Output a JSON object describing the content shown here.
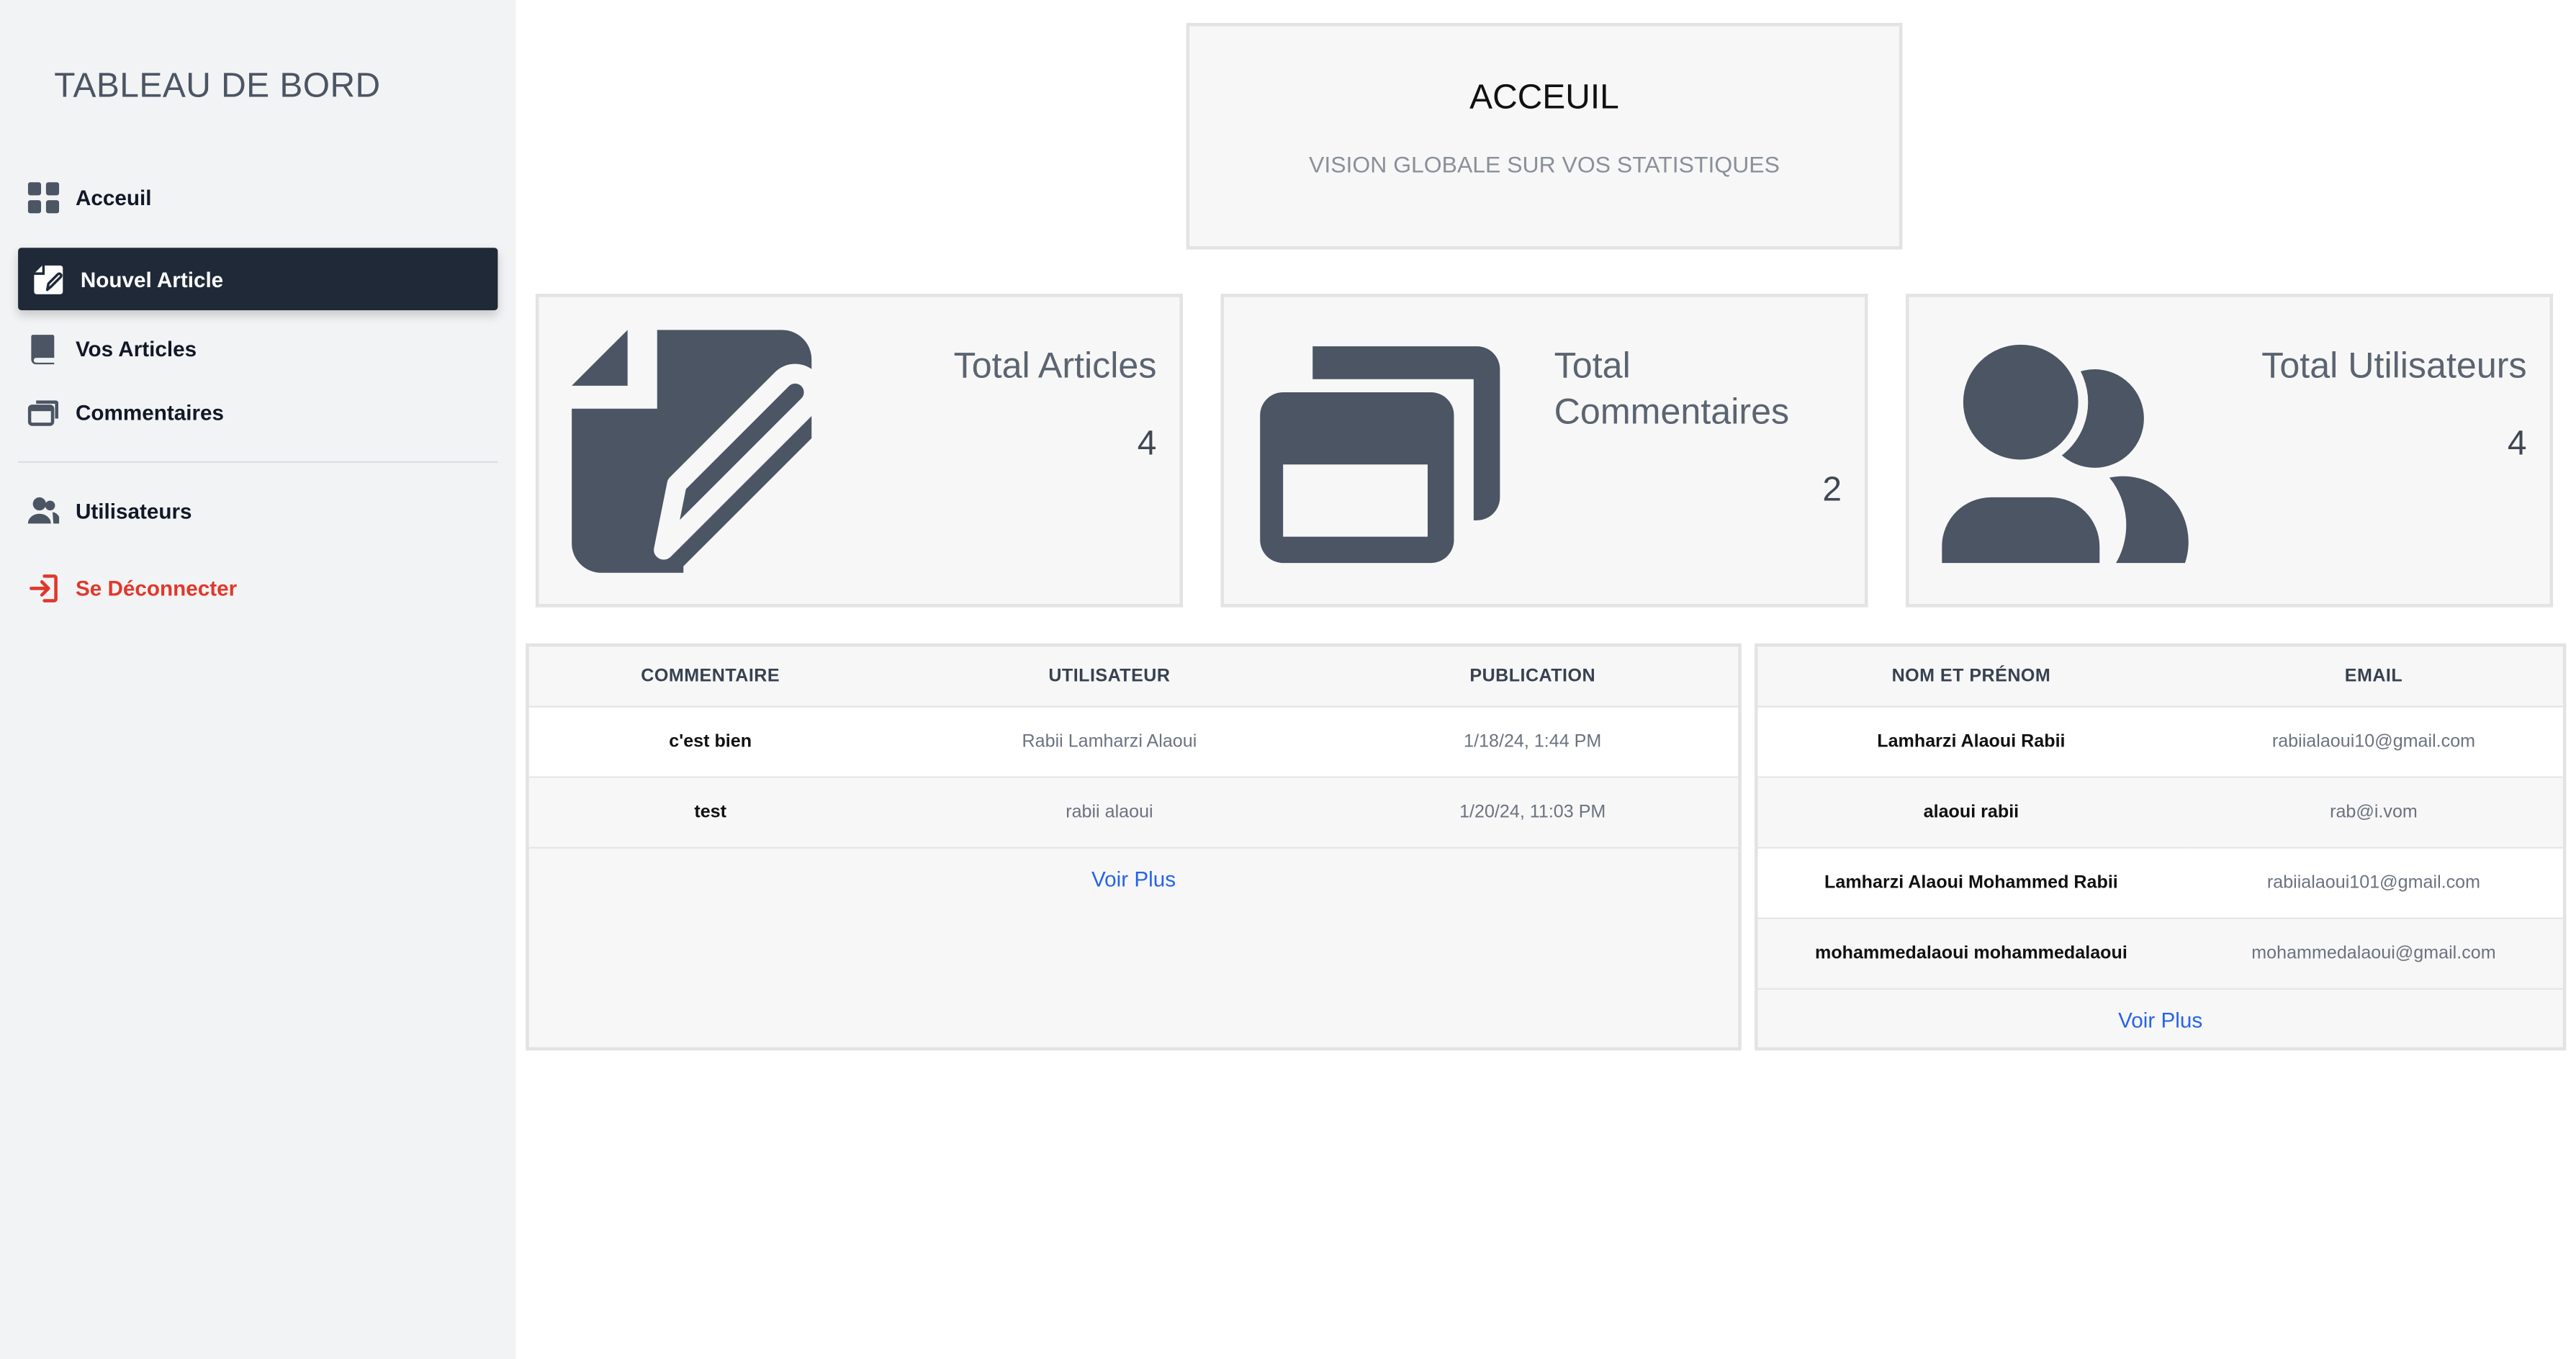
{
  "sidebar": {
    "title": "TABLEAU DE BORD",
    "items": [
      {
        "label": "Acceuil",
        "icon": "grid-icon"
      },
      {
        "label": "Nouvel Article",
        "icon": "pen-square-icon",
        "active": true
      },
      {
        "label": "Vos Articles",
        "icon": "book-icon"
      },
      {
        "label": "Commentaires",
        "icon": "windows-icon"
      },
      {
        "label": "Utilisateurs",
        "icon": "users-icon"
      },
      {
        "label": "Se Déconnecter",
        "icon": "logout-icon"
      }
    ]
  },
  "header": {
    "title": "ACCEUIL",
    "subtitle": "VISION GLOBALE SUR VOS STATISTIQUES"
  },
  "stats": [
    {
      "title": "Total Articles",
      "value": "4",
      "icon": "pen-square-icon"
    },
    {
      "title": "Total Commentaires",
      "value": "2",
      "icon": "windows-icon"
    },
    {
      "title": "Total Utilisateurs",
      "value": "4",
      "icon": "users-icon"
    }
  ],
  "comments_table": {
    "headers": [
      "COMMENTAIRE",
      "UTILISATEUR",
      "PUBLICATION"
    ],
    "rows": [
      {
        "comment": "c'est bien",
        "user": "Rabii Lamharzi Alaoui",
        "date": "1/18/24, 1:44 PM"
      },
      {
        "comment": "test",
        "user": "rabii alaoui",
        "date": "1/20/24, 11:03 PM"
      }
    ],
    "more_label": "Voir Plus"
  },
  "users_table": {
    "headers": [
      "NOM ET PRÉNOM",
      "EMAIL"
    ],
    "rows": [
      {
        "name": "Lamharzi Alaoui Rabii",
        "email": "rabiialaoui10@gmail.com"
      },
      {
        "name": "alaoui rabii",
        "email": "rab@i.vom"
      },
      {
        "name": "Lamharzi Alaoui Mohammed Rabii",
        "email": "rabiialaoui101@gmail.com"
      },
      {
        "name": "mohammedalaoui mohammedalaoui",
        "email": "mohammedalaoui@gmail.com"
      }
    ],
    "more_label": "Voir Plus"
  },
  "colors": {
    "sidebar_bg": "#f2f3f5",
    "active_bg": "#1f2937",
    "logout": "#e0382b",
    "icon": "#4b5563",
    "link": "#2563eb"
  }
}
